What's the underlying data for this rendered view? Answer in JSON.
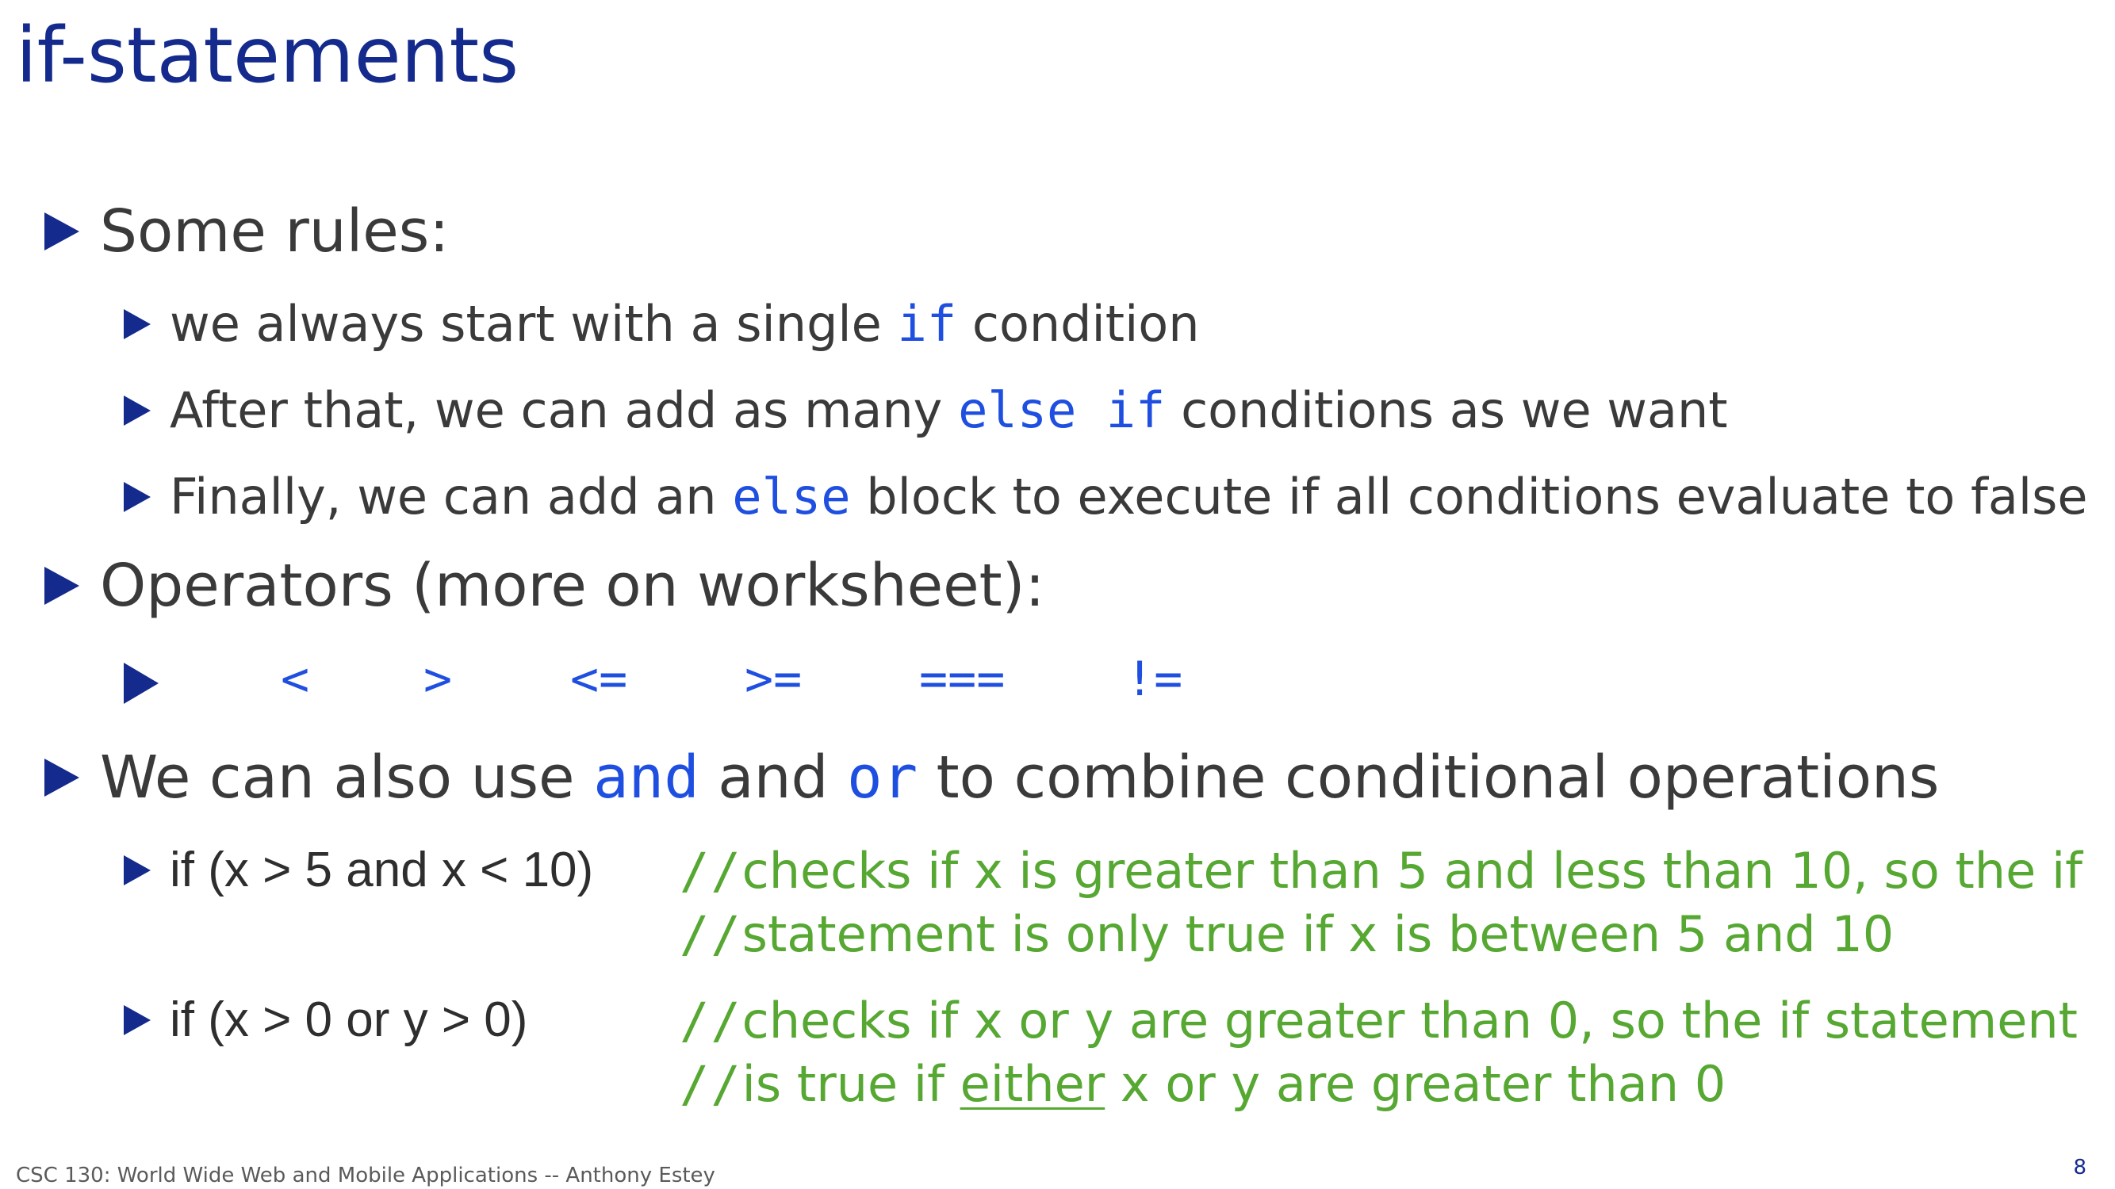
{
  "slide": {
    "title": "if-statements",
    "rules_heading": "Some rules:",
    "rules": [
      {
        "before": "we always start with a single ",
        "code": "if",
        "after": " condition"
      },
      {
        "before": "After that, we can add as many ",
        "code": "else if",
        "after": " conditions as we want"
      },
      {
        "before": "Finally, we can add an ",
        "code": "else",
        "after": " block to execute if all conditions evaluate to false"
      }
    ],
    "operators_heading": "Operators (more on worksheet):",
    "operators": [
      "<",
      ">",
      "<=",
      ">=",
      "===",
      "!="
    ],
    "combine": {
      "before": "We can also use ",
      "and_code": "and",
      "middle": " and ",
      "or_code": "or",
      "after": " to combine conditional operations"
    },
    "examples": [
      {
        "code": "if (x > 5 and x < 10)",
        "comment_slash_1": "//",
        "comment_line_1": "checks if x is greater than 5 and less than 10, so the if",
        "comment_slash_2": "//",
        "comment_line_2": "statement is only true if x is between 5 and 10"
      },
      {
        "code": "if (x > 0 or y > 0)",
        "comment_slash_1": "//",
        "comment_line_1": "checks if x or y are greater than 0, so the if statement",
        "comment_slash_2": "//",
        "comment_line_2_before": "is true if ",
        "comment_line_2_underlined": "either",
        "comment_line_2_after": " x or y are greater than 0"
      }
    ],
    "footer": "CSC 130: World Wide Web and Mobile Applications -- Anthony Estey",
    "page_number": "8",
    "colors": {
      "title": "#142a8c",
      "keyword": "#1f4fe0",
      "comment": "#56a832",
      "body": "#3a3a3a"
    }
  }
}
